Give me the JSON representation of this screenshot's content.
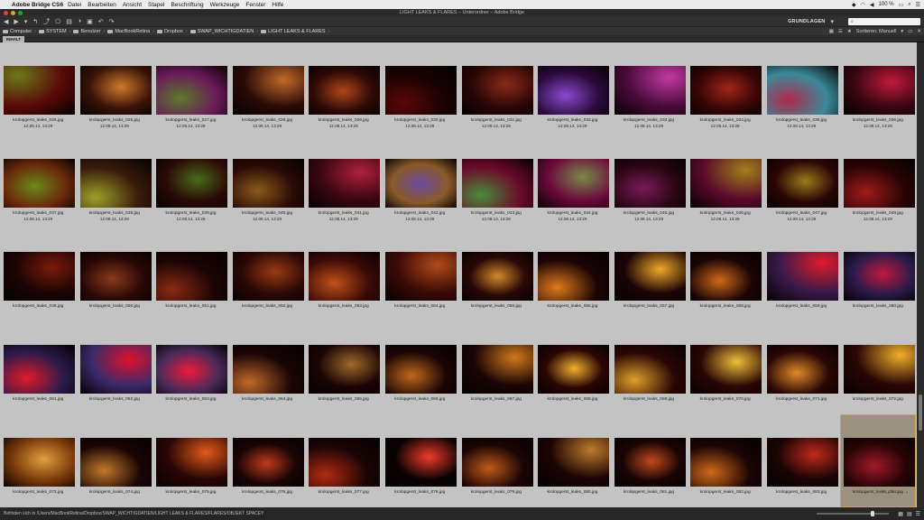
{
  "menubar": {
    "app_name": "Adobe Bridge CS6",
    "items": [
      "Datei",
      "Bearbeiten",
      "Ansicht",
      "Stapel",
      "Beschriftung",
      "Werkzeuge",
      "Fenster",
      "Hilfe"
    ],
    "battery": "100 %"
  },
  "window": {
    "title": "LIGHT LEAKS & FLARES – Unterordner – Adobe Bridge"
  },
  "toolbar": {
    "workspace": "GRUNDLAGEN",
    "search_placeholder": ""
  },
  "path": [
    {
      "label": "Computer"
    },
    {
      "label": "SYSTEM"
    },
    {
      "label": "Benutzer"
    },
    {
      "label": "MacBookRetina"
    },
    {
      "label": "Dropbox"
    },
    {
      "label": "SWAP_WICHTIGDATIEN"
    },
    {
      "label": "LIGHT LEAKS & FLARES"
    }
  ],
  "sort": {
    "label": "Sortieren: Manuell"
  },
  "tab": {
    "label": "INHALT"
  },
  "files": [
    {
      "name": "krolopgerst_leaks_025.jpg",
      "date": "12.08.14, 13:29",
      "c1": "#6a7a1a",
      "c2": "#5a0a08"
    },
    {
      "name": "krolopgerst_leaks_026.jpg",
      "date": "12.08.14, 13:29",
      "c1": "#d07a2a",
      "c2": "#3a1208"
    },
    {
      "name": "krolopgerst_leaks_027.jpg",
      "date": "12.08.14, 13:29",
      "c1": "#5a7a2a",
      "c2": "#6a1a5a"
    },
    {
      "name": "krolopgerst_leaks_028.jpg",
      "date": "12.08.14, 13:29",
      "c1": "#c06a2a",
      "c2": "#2a0a06"
    },
    {
      "name": "krolopgerst_leaks_029.jpg",
      "date": "12.08.14, 13:29",
      "c1": "#b04818",
      "c2": "#300a06"
    },
    {
      "name": "krolopgerst_leaks_030.jpg",
      "date": "12.08.14, 13:29",
      "c1": "#5a0808",
      "c2": "#180202"
    },
    {
      "name": "krolopgerst_leaks_031.jpg",
      "date": "12.08.14, 13:29",
      "c1": "#8a2a1a",
      "c2": "#2a0606"
    },
    {
      "name": "krolopgerst_leaks_032.jpg",
      "date": "12.08.14, 13:29",
      "c1": "#8a4ad0",
      "c2": "#2a0a3a"
    },
    {
      "name": "krolopgerst_leaks_033.jpg",
      "date": "12.08.14, 13:29",
      "c1": "#c03aa0",
      "c2": "#4a0a3a"
    },
    {
      "name": "krolopgerst_leaks_034.jpg",
      "date": "12.08.14, 13:29",
      "c1": "#a0261a",
      "c2": "#3a0606"
    },
    {
      "name": "krolopgerst_leaks_035.jpg",
      "date": "12.08.14, 13:29",
      "c1": "#b0284a",
      "c2": "#3a8a9a"
    },
    {
      "name": "krolopgerst_leaks_036.jpg",
      "date": "12.08.14, 13:29",
      "c1": "#c01a3a",
      "c2": "#3a0612"
    },
    {
      "name": "krolopgerst_leaks_037.jpg",
      "date": "12.08.14, 13:29",
      "c1": "#6a8a1a",
      "c2": "#6a2a0a"
    },
    {
      "name": "krolopgerst_leaks_038.jpg",
      "date": "12.08.14, 13:29",
      "c1": "#9aa02a",
      "c2": "#3a1a0a"
    },
    {
      "name": "krolopgerst_leaks_039.jpg",
      "date": "12.08.14, 13:29",
      "c1": "#4a6a1a",
      "c2": "#2a0a06"
    },
    {
      "name": "krolopgerst_leaks_040.jpg",
      "date": "12.08.14, 13:29",
      "c1": "#8a5a1a",
      "c2": "#2a0a06"
    },
    {
      "name": "krolopgerst_leaks_041.jpg",
      "date": "12.08.14, 13:29",
      "c1": "#b0203a",
      "c2": "#3a0612"
    },
    {
      "name": "krolopgerst_leaks_042.jpg",
      "date": "12.08.14, 13:29",
      "c1": "#6a4aa0",
      "c2": "#8a5a2a"
    },
    {
      "name": "krolopgerst_leaks_043.jpg",
      "date": "12.08.14, 13:29",
      "c1": "#4a8a3a",
      "c2": "#6a0a2a"
    },
    {
      "name": "krolopgerst_leaks_044.jpg",
      "date": "12.08.14, 13:29",
      "c1": "#7a8a4a",
      "c2": "#6a0a3a"
    },
    {
      "name": "krolopgerst_leaks_045.jpg",
      "date": "12.08.14, 13:29",
      "c1": "#7a1a5a",
      "c2": "#2a0614"
    },
    {
      "name": "krolopgerst_leaks_046.jpg",
      "date": "12.08.14, 13:29",
      "c1": "#a0801a",
      "c2": "#5a0a2a"
    },
    {
      "name": "krolopgerst_leaks_047.jpg",
      "date": "12.08.14, 13:29",
      "c1": "#9a7a1a",
      "c2": "#2a0606"
    },
    {
      "name": "krolopgerst_leaks_048.jpg",
      "date": "12.08.14, 13:29",
      "c1": "#a01a1a",
      "c2": "#2a0404"
    },
    {
      "name": "krolopgerst_leaks_049.jpg",
      "date": "",
      "c1": "#7a1a0a",
      "c2": "#1a0404"
    },
    {
      "name": "krolopgerst_leaks_050.jpg",
      "date": "",
      "c1": "#8a3a1a",
      "c2": "#2a0806"
    },
    {
      "name": "krolopgerst_leaks_051.jpg",
      "date": "",
      "c1": "#8a2a12",
      "c2": "#1a0404"
    },
    {
      "name": "krolopgerst_leaks_052.jpg",
      "date": "",
      "c1": "#9a3a12",
      "c2": "#2a0806"
    },
    {
      "name": "krolopgerst_leaks_053.jpg",
      "date": "",
      "c1": "#c0501a",
      "c2": "#3a0a06"
    },
    {
      "name": "krolopgerst_leaks_054.jpg",
      "date": "",
      "c1": "#b04a1a",
      "c2": "#3a0a06"
    },
    {
      "name": "krolopgerst_leaks_055.jpg",
      "date": "",
      "c1": "#d08a2a",
      "c2": "#2a0806"
    },
    {
      "name": "krolopgerst_leaks_056.jpg",
      "date": "",
      "c1": "#e07a1a",
      "c2": "#1a0404"
    },
    {
      "name": "krolopgerst_leaks_057.jpg",
      "date": "",
      "c1": "#f0a82a",
      "c2": "#1a0404"
    },
    {
      "name": "krolopgerst_leaks_058.jpg",
      "date": "",
      "c1": "#d06a1a",
      "c2": "#1a0404"
    },
    {
      "name": "krolopgerst_leaks_059.jpg",
      "date": "",
      "c1": "#e01a2a",
      "c2": "#3a1a4a"
    },
    {
      "name": "krolopgerst_leaks_060.jpg",
      "date": "",
      "c1": "#c01a3a",
      "c2": "#2a1a4a"
    },
    {
      "name": "krolopgerst_leaks_061.jpg",
      "date": "",
      "c1": "#e01a2a",
      "c2": "#2a1a4a"
    },
    {
      "name": "krolopgerst_leaks_062.jpg",
      "date": "",
      "c1": "#e0102a",
      "c2": "#3a2a6a"
    },
    {
      "name": "krolopgerst_leaks_063.jpg",
      "date": "",
      "c1": "#f01a3a",
      "c2": "#4a2a5a"
    },
    {
      "name": "krolopgerst_leaks_064.jpg",
      "date": "",
      "c1": "#c06a2a",
      "c2": "#1a0404"
    },
    {
      "name": "krolopgerst_leaks_065.jpg",
      "date": "",
      "c1": "#a06a2a",
      "c2": "#1a0404"
    },
    {
      "name": "krolopgerst_leaks_066.jpg",
      "date": "",
      "c1": "#c06a1a",
      "c2": "#1a0404"
    },
    {
      "name": "krolopgerst_leaks_067.jpg",
      "date": "",
      "c1": "#d07a1a",
      "c2": "#1a0404"
    },
    {
      "name": "krolopgerst_leaks_068.jpg",
      "date": "",
      "c1": "#f0b030",
      "c2": "#2a0604"
    },
    {
      "name": "krolopgerst_leaks_069.jpg",
      "date": "",
      "c1": "#e0a02a",
      "c2": "#2a0604"
    },
    {
      "name": "krolopgerst_leaks_070.jpg",
      "date": "",
      "c1": "#f0c03a",
      "c2": "#2a0604"
    },
    {
      "name": "krolopgerst_leaks_071.jpg",
      "date": "",
      "c1": "#e08a2a",
      "c2": "#2a0604"
    },
    {
      "name": "krolopgerst_leaks_072.jpg",
      "date": "",
      "c1": "#f0b02a",
      "c2": "#2a0604"
    },
    {
      "name": "krolopgerst_leaks_073.jpg",
      "date": "",
      "c1": "#e0a040",
      "c2": "#7a3a0a"
    },
    {
      "name": "krolopgerst_leaks_074.jpg",
      "date": "",
      "c1": "#c07a2a",
      "c2": "#1a0404"
    },
    {
      "name": "krolopgerst_leaks_075.jpg",
      "date": "",
      "c1": "#e05a1a",
      "c2": "#2a0604"
    },
    {
      "name": "krolopgerst_leaks_076.jpg",
      "date": "",
      "c1": "#c03a1a",
      "c2": "#1a0404"
    },
    {
      "name": "krolopgerst_leaks_077.jpg",
      "date": "",
      "c1": "#b02a12",
      "c2": "#1a0404"
    },
    {
      "name": "krolopgerst_leaks_078.jpg",
      "date": "",
      "c1": "#f03a2a",
      "c2": "#0a0202"
    },
    {
      "name": "krolopgerst_leaks_079.jpg",
      "date": "",
      "c1": "#c05a1a",
      "c2": "#1a0404"
    },
    {
      "name": "krolopgerst_leaks_080.jpg",
      "date": "",
      "c1": "#c07a2a",
      "c2": "#1a0404"
    },
    {
      "name": "krolopgerst_leaks_081.jpg",
      "date": "",
      "c1": "#c04a1a",
      "c2": "#1a0404"
    },
    {
      "name": "krolopgerst_leaks_082.jpg",
      "date": "",
      "c1": "#d06a1a",
      "c2": "#1a0404"
    },
    {
      "name": "krolopgerst_leaks_083.jpg",
      "date": "",
      "c1": "#c02a1a",
      "c2": "#1a0404"
    },
    {
      "name": "krolopgerst_leaks_084.jpg",
      "date": "",
      "c1": "#a01a2a",
      "c2": "#2a0406",
      "selected": true
    }
  ],
  "status": {
    "text": "Befinden sich in /Users/MacBookRetina/Dropbox/SWAP_WICHTIGDATIEN/LIGHT LEAKS & FLARES/FLARES/OBJEKT SPACEY"
  },
  "zoom": {
    "level": 0.78
  },
  "colors": {
    "content_bg": "#c3c3c3",
    "selection": "#c9a45a"
  }
}
